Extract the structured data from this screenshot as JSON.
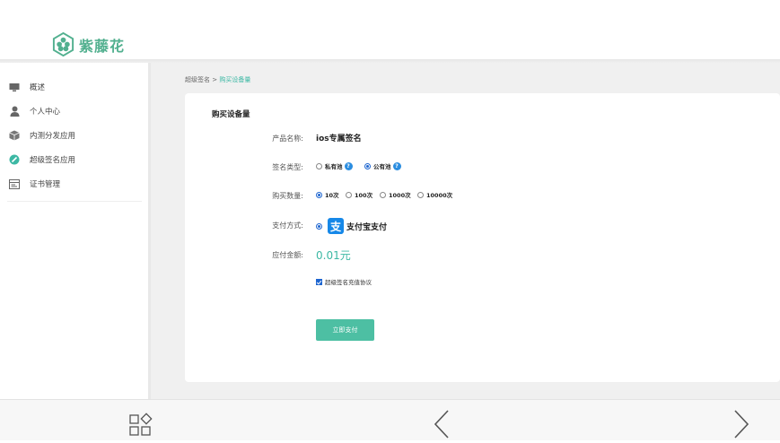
{
  "brand": {
    "name": "紫藤花"
  },
  "sidebar": {
    "items": [
      {
        "label": "概述",
        "icon": "monitor-icon"
      },
      {
        "label": "个人中心",
        "icon": "user-icon"
      },
      {
        "label": "内测分发应用",
        "icon": "box-icon"
      },
      {
        "label": "超级签名应用",
        "icon": "edit-icon"
      },
      {
        "label": "证书管理",
        "icon": "certificate-icon"
      }
    ]
  },
  "breadcrumb": {
    "parent": "超级签名",
    "separator": " > ",
    "current": "购买设备量"
  },
  "form": {
    "title": "购买设备量",
    "product": {
      "label": "产品名称:",
      "value": "ios专属签名"
    },
    "sign_type": {
      "label": "签名类型:",
      "options": [
        {
          "text": "私有池",
          "checked": false,
          "help": "?"
        },
        {
          "text": "公有池",
          "checked": true,
          "help": "?"
        }
      ]
    },
    "quantity": {
      "label": "购买数量:",
      "options": [
        {
          "text": "10次",
          "checked": true
        },
        {
          "text": "100次",
          "checked": false
        },
        {
          "text": "1000次",
          "checked": false
        },
        {
          "text": "10000次",
          "checked": false
        }
      ]
    },
    "payment": {
      "label": "支付方式:",
      "method": "支付宝支付",
      "logo_char": "支"
    },
    "amount": {
      "label": "应付金额:",
      "value": "0.01元"
    },
    "agreement": {
      "text": "超级签名充值协议",
      "checked": true
    },
    "submit_label": "立即支付"
  },
  "colors": {
    "accent": "#3cb8a4",
    "button": "#4dbfa3",
    "alipay": "#1688e8",
    "radio": "#1e66d0"
  }
}
